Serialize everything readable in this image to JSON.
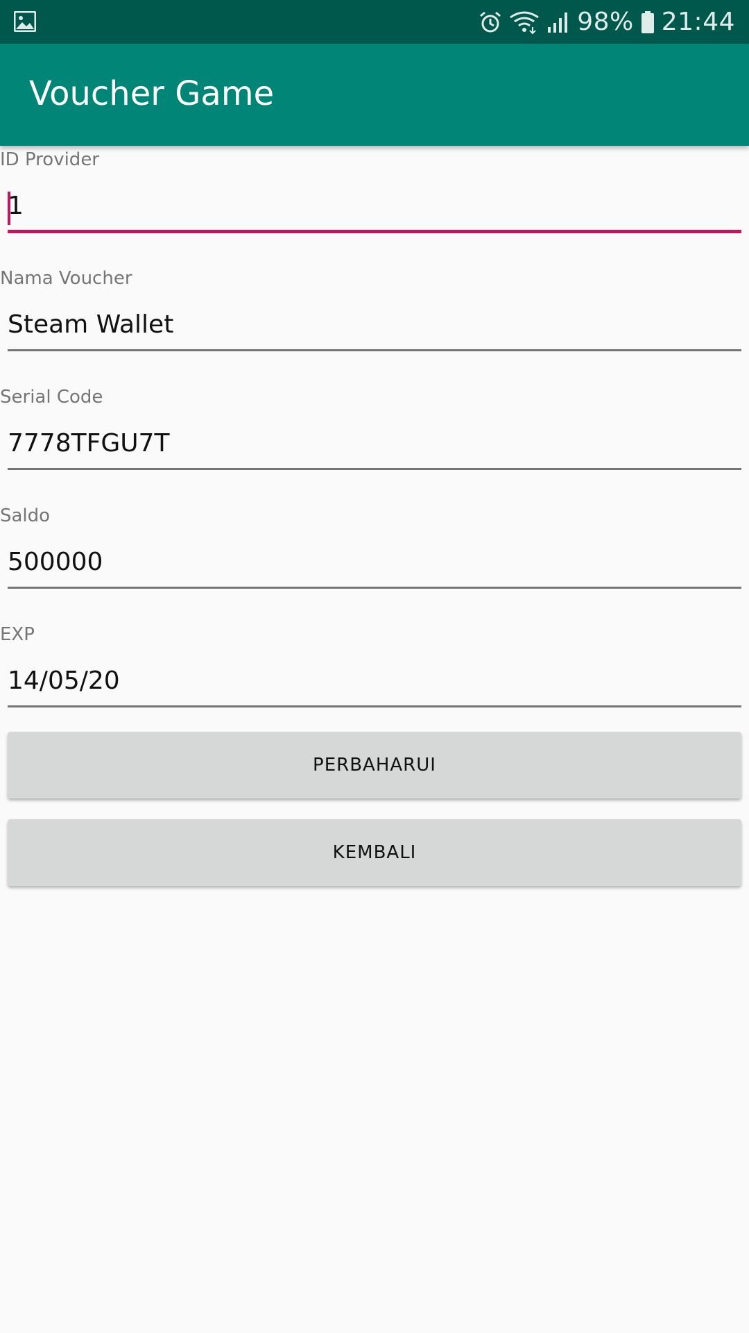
{
  "status_bar": {
    "left_icon": "image-icon",
    "icons": [
      "alarm-icon",
      "wifi-icon",
      "signal-icon",
      "battery-icon"
    ],
    "battery_percent": "98%",
    "time": "21:44"
  },
  "app_bar": {
    "title": "Voucher Game",
    "color": "#008577",
    "status_color": "#00574b"
  },
  "form": {
    "fields": [
      {
        "label": "ID Provider",
        "value": "1",
        "focused": true
      },
      {
        "label": "Nama Voucher",
        "value": "Steam Wallet",
        "focused": false
      },
      {
        "label": "Serial Code",
        "value": "7778TFGU7T",
        "focused": false
      },
      {
        "label": "Saldo",
        "value": "500000",
        "focused": false
      },
      {
        "label": "EXP",
        "value": "14/05/20",
        "focused": false
      }
    ],
    "accent_color": "#c2185b"
  },
  "buttons": {
    "update_label": "PERBAHARUI",
    "back_label": "KEMBALI"
  }
}
